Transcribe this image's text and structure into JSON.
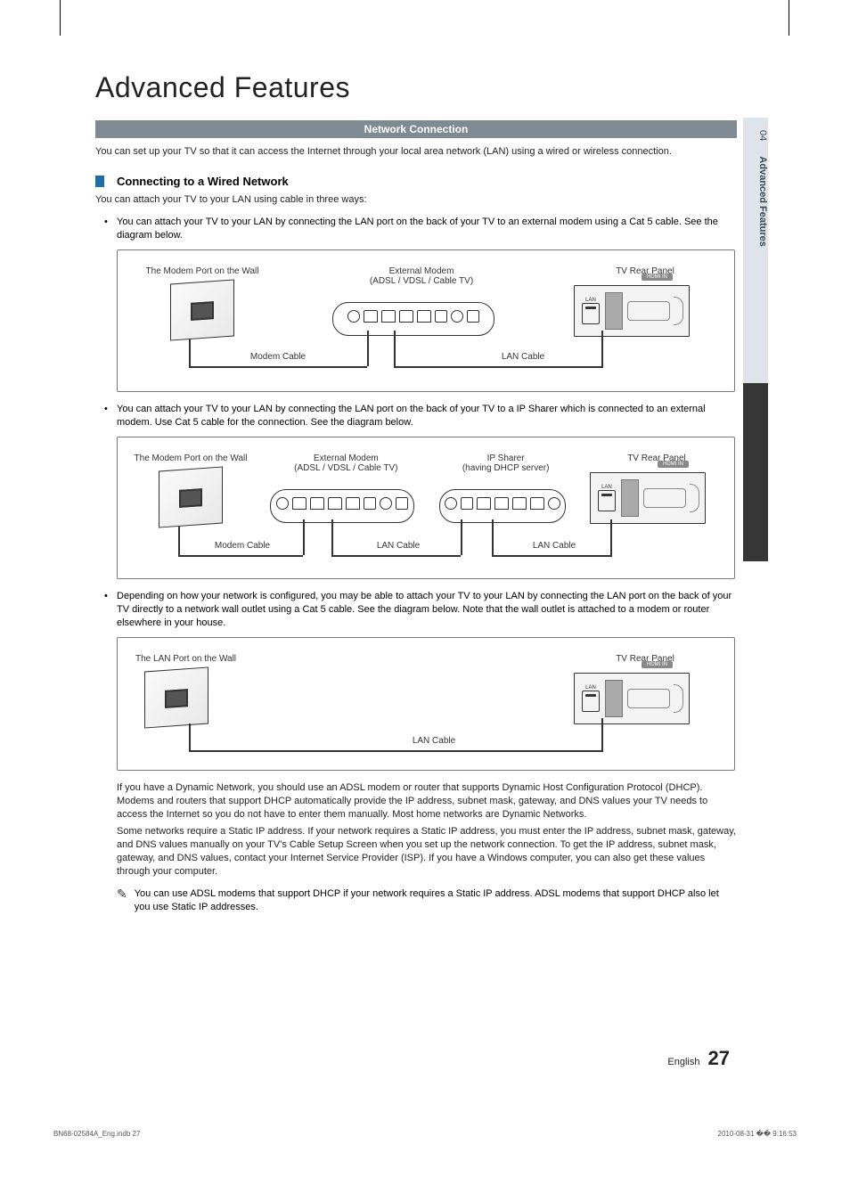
{
  "sidebar": {
    "number": "04",
    "title": "Advanced Features"
  },
  "chapter_title": "Advanced Features",
  "section_bar": "Network Connection",
  "intro": "You can set up your TV so that it can access the Internet through your local area network (LAN) using a wired or wireless connection.",
  "subheading": "Connecting to a Wired Network",
  "lead_in": "You can attach your TV to your LAN using cable in three ways:",
  "bullets": [
    "You can attach your TV to your LAN by connecting the LAN port on the back of your TV to an external modem using a Cat 5 cable. See the diagram below.",
    "You can attach your TV to your LAN by connecting the LAN port on the back of your TV to a IP Sharer which is connected to an external modem. Use Cat 5 cable for the connection. See the diagram below.",
    "Depending on how your network is configured, you may be able to attach your TV to your LAN by connecting the LAN port on the back of your TV directly to a network wall outlet using a Cat 5 cable. See the diagram below. Note that the wall outlet is attached to a modem or router elsewhere in your house."
  ],
  "diagram1": {
    "wall_label": "The Modem Port on the Wall",
    "modem_label_line1": "External Modem",
    "modem_label_line2": "(ADSL / VDSL / Cable TV)",
    "tv_label": "TV Rear Panel",
    "cable1": "Modem Cable",
    "cable2": "LAN Cable",
    "tv_port": "LAN"
  },
  "diagram2": {
    "wall_label": "The Modem Port on the Wall",
    "modem_label_line1": "External Modem",
    "modem_label_line2": "(ADSL / VDSL / Cable TV)",
    "sharer_label_line1": "IP Sharer",
    "sharer_label_line2": "(having DHCP server)",
    "tv_label": "TV Rear Panel",
    "cable1": "Modem Cable",
    "cable2": "LAN Cable",
    "cable3": "LAN Cable",
    "tv_port": "LAN"
  },
  "diagram3": {
    "wall_label": "The LAN Port on the Wall",
    "tv_label": "TV Rear Panel",
    "cable1": "LAN Cable",
    "tv_port": "LAN"
  },
  "explain_para1": "If you have a Dynamic Network, you should use an ADSL modem or router that supports Dynamic Host Configuration Protocol (DHCP). Modems and routers that support DHCP automatically provide the IP address, subnet mask, gateway, and DNS values your TV needs to access the Internet so you do not have to enter them manually. Most home networks are Dynamic Networks.",
  "explain_para2": "Some networks require a Static IP address. If your network requires a Static IP address, you must enter the IP address, subnet mask, gateway, and DNS values manually on your TV's Cable Setup Screen when you set up the network connection. To get the IP address, subnet mask, gateway, and DNS values, contact your Internet Service Provider (ISP). If you have a Windows computer, you can also get these values through your computer.",
  "note_text": "You can use ADSL modems that support DHCP if your network requires a Static IP address. ADSL modems that support DHCP also let you use Static IP addresses.",
  "footer": {
    "lang": "English",
    "page": "27"
  },
  "print_footer": {
    "file": "BN68-02584A_Eng.indb   27",
    "date": "2010-08-31   �� 9:16:53"
  }
}
